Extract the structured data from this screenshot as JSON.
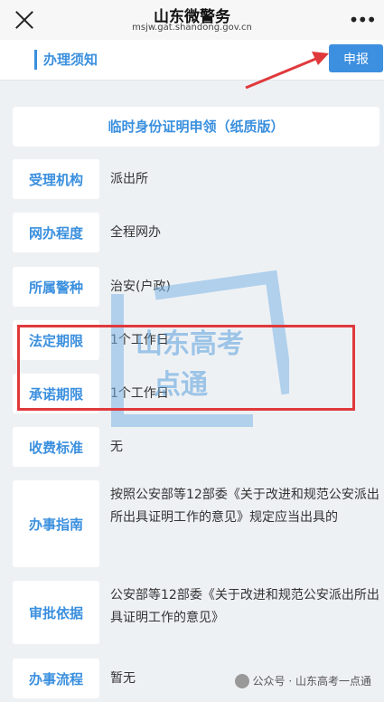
{
  "nav": {
    "title": "山东微警务",
    "subtitle": "msjw.gat.shandong.gov.cn",
    "more_label": "•••"
  },
  "tab": {
    "label": "办理须知"
  },
  "apply_button": "申报",
  "service_title": "临时身份证明申领（纸质版）",
  "rows": [
    {
      "label": "受理机构",
      "value": "派出所"
    },
    {
      "label": "网办程度",
      "value": "全程网办"
    },
    {
      "label": "所属警种",
      "value": "治安(户政)"
    },
    {
      "label": "法定期限",
      "value": "1个工作日"
    },
    {
      "label": "承诺期限",
      "value": "1个工作日"
    },
    {
      "label": "收费标准",
      "value": "无"
    },
    {
      "label": "办事指南",
      "value": "按照公安部等12部委《关于改进和规范公安派出所出具证明工作的意见》规定应当出具的"
    },
    {
      "label": "审批依据",
      "value": "公安部等12部委《关于改进和规范公安派出所出具证明工作的意见》"
    },
    {
      "label": "办事流程",
      "value": "暂无"
    }
  ],
  "watermark": {
    "line1": "山东高考",
    "line2": "点通"
  },
  "footer": "公众号 · 山东高考一点通",
  "colors": {
    "accent": "#3a8fde",
    "highlight": "#e0393c",
    "background": "#eef1f4"
  }
}
